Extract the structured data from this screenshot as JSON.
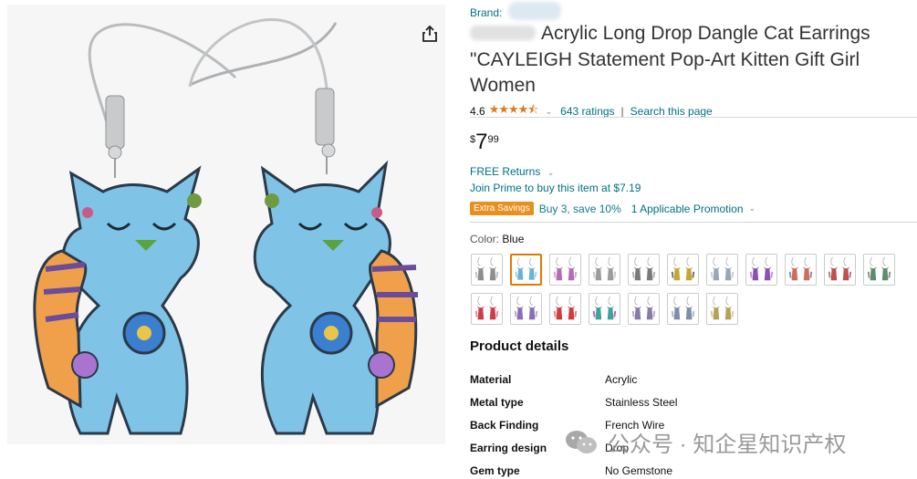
{
  "share": {
    "icon": "share-icon"
  },
  "product": {
    "brand": "Brand:",
    "title_rest": "Acrylic Long Drop Dangle Cat Earrings \"CAYLEIGH Statement Pop-Art Kitten Gift Girl Women",
    "rating": "4.6",
    "stars": "★★★★⯪",
    "rating_chevron": "⌄",
    "ratings_link": "643 ratings",
    "rating_separator": "|",
    "search_link": "Search this page",
    "price_symbol": "$",
    "price_whole": "7",
    "price_fraction": "99",
    "returns": "FREE Returns",
    "returns_chevron": "⌄",
    "prime": "Join Prime to buy this item at $7.19",
    "promo_badge": "Extra Savings",
    "promo_offer": "Buy 3, save 10%",
    "promo_link": "1 Applicable Promotion",
    "promo_chevron": "⌄",
    "color_label": "Color:",
    "color_value": "Blue"
  },
  "swatches": [
    {
      "name": "variant-1",
      "colors": [
        "#8e8e8e",
        "#bdbdbd"
      ]
    },
    {
      "name": "variant-2",
      "colors": [
        "#6ab0d8",
        "#9fd0ea"
      ],
      "selected": true
    },
    {
      "name": "variant-3",
      "colors": [
        "#b66cb0",
        "#d5a3d0"
      ]
    },
    {
      "name": "variant-4",
      "colors": [
        "#9c9c9c",
        "#c9c9c9"
      ]
    },
    {
      "name": "variant-5",
      "colors": [
        "#7a7a7a",
        "#b0b0b0"
      ]
    },
    {
      "name": "variant-6",
      "colors": [
        "#c3a735",
        "#6f6f6f"
      ]
    },
    {
      "name": "variant-7",
      "colors": [
        "#9aa6b6",
        "#c7cdd6"
      ]
    },
    {
      "name": "variant-8",
      "colors": [
        "#8d4fb2",
        "#c391d9"
      ]
    },
    {
      "name": "variant-9",
      "colors": [
        "#d06c5a",
        "#7f8fb6"
      ]
    },
    {
      "name": "variant-10",
      "colors": [
        "#c0504d",
        "#8a8a8a"
      ]
    },
    {
      "name": "variant-11",
      "colors": [
        "#5b8f6c",
        "#8e8e8e"
      ]
    },
    {
      "name": "variant-12",
      "colors": [
        "#cc3d4a",
        "#e08a91"
      ]
    },
    {
      "name": "variant-13",
      "colors": [
        "#8a6fb6",
        "#b7a5d6"
      ]
    },
    {
      "name": "variant-14",
      "colors": [
        "#d23b3b",
        "#e77b7b"
      ]
    },
    {
      "name": "variant-15",
      "colors": [
        "#3aa59b",
        "#c25cb3"
      ]
    },
    {
      "name": "variant-16",
      "colors": [
        "#8a7aa8",
        "#b5aacb"
      ]
    },
    {
      "name": "variant-17",
      "colors": [
        "#7d8fa8",
        "#aab8ca"
      ]
    },
    {
      "name": "variant-18",
      "colors": [
        "#b4a15a",
        "#d6c98f"
      ]
    }
  ],
  "details": {
    "heading": "Product details",
    "rows": [
      {
        "key": "Material",
        "value": "Acrylic"
      },
      {
        "key": "Metal type",
        "value": "Stainless Steel"
      },
      {
        "key": "Back Finding",
        "value": "French Wire"
      },
      {
        "key": "Earring design",
        "value": "Drop"
      },
      {
        "key": "Gem type",
        "value": "No Gemstone"
      }
    ]
  },
  "watermark": {
    "text": "公众号 · 知企星知识产权",
    "icon": "wechat-icon"
  }
}
